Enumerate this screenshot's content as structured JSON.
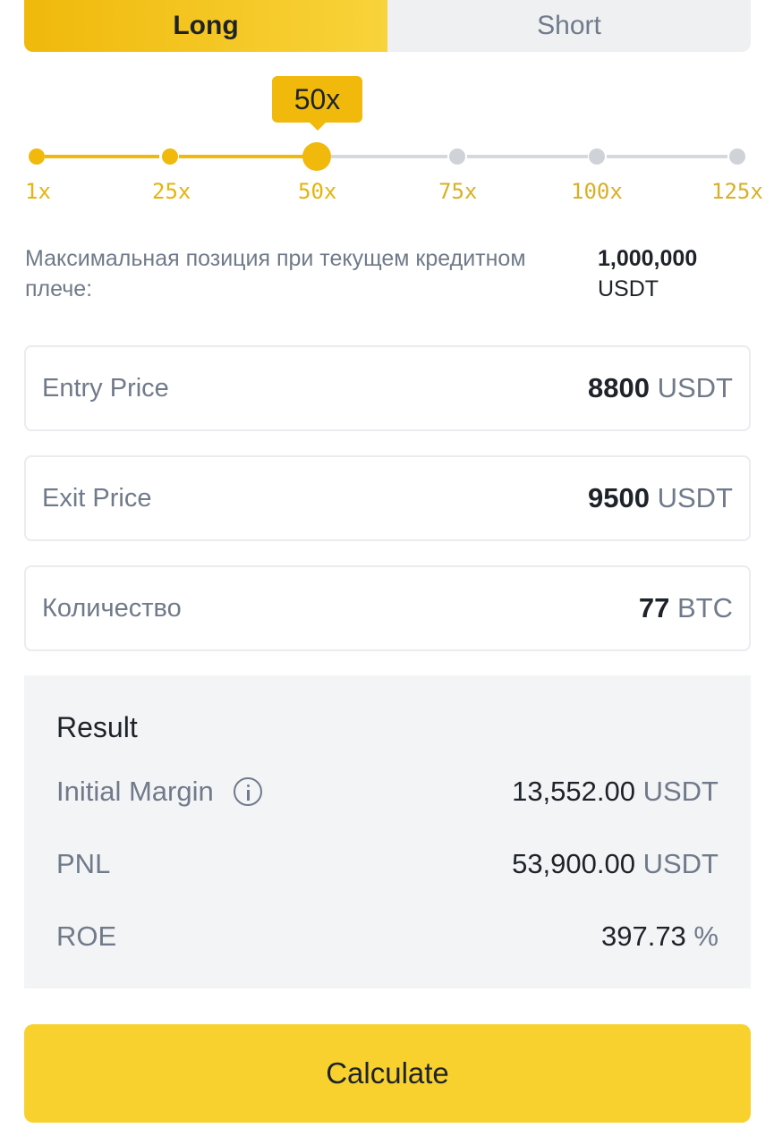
{
  "tabs": {
    "long": "Long",
    "short": "Short",
    "active": "long"
  },
  "leverage": {
    "current": "50x",
    "ticks": [
      "1x",
      "25x",
      "50x",
      "75x",
      "100x",
      "125x"
    ],
    "selected_index": 2
  },
  "max_position": {
    "label": "Максимальная позиция при текущем кредитном плече:",
    "value": "1,000,000",
    "unit": "USDT"
  },
  "inputs": {
    "entry": {
      "label": "Entry Price",
      "value": "8800",
      "unit": "USDT"
    },
    "exit": {
      "label": "Exit Price",
      "value": "9500",
      "unit": "USDT"
    },
    "quantity": {
      "label": "Количество",
      "value": "77",
      "unit": "BTC"
    }
  },
  "result": {
    "title": "Result",
    "initial_margin": {
      "label": "Initial Margin",
      "value": "13,552.00",
      "unit": "USDT"
    },
    "pnl": {
      "label": "PNL",
      "value": "53,900.00",
      "unit": "USDT"
    },
    "roe": {
      "label": "ROE",
      "value": "397.73",
      "unit": "%"
    }
  },
  "calculate_label": "Calculate",
  "colors": {
    "accent": "#f0b90b",
    "button": "#f8d12f",
    "muted": "#707a8a",
    "text": "#1e2329",
    "panel": "#f3f4f6"
  },
  "icons": {
    "info": "info-circle-icon"
  }
}
